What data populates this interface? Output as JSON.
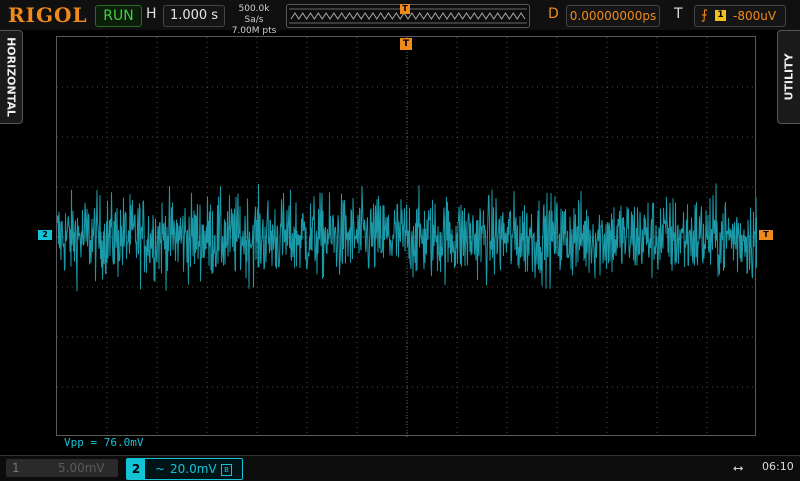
{
  "header": {
    "brand": "RIGOL",
    "run_state": "RUN",
    "horizontal_label": "H",
    "timebase": "1.000 s",
    "sample_rate": "500.0k Sa/s",
    "memory_depth": "7.00M pts",
    "delay_label": "D",
    "delay_value": "0.00000000ps",
    "trigger_label": "T",
    "trigger_source": "1",
    "trigger_level": "-800uV",
    "trigger_position_marker": "T"
  },
  "side_tabs": {
    "left": "HORIZONTAL",
    "right": "UTILITY"
  },
  "markers": {
    "channel2": "2",
    "trigger_level": "T",
    "trigger_position": "T"
  },
  "measurement": {
    "text": "Vpp = 76.0mV"
  },
  "channels": {
    "ch1": {
      "number": "1",
      "scale": "5.00mV"
    },
    "ch2": {
      "number": "2",
      "coupling": "~",
      "scale": "20.0mV",
      "bw_icon": "B"
    }
  },
  "status": {
    "usb_icon": "usb-icon",
    "time": "06:10"
  },
  "colors": {
    "brand": "#f08a1c",
    "channel2": "#13c4d6",
    "run": "#40d040",
    "trigger": "#f08a1c"
  },
  "chart_data": {
    "type": "line",
    "title": "",
    "xlabel": "",
    "ylabel": "",
    "xdivs": 14,
    "ydivs": 8,
    "grid": true,
    "series": [
      {
        "name": "",
        "vpp_mV": 76.0,
        "scale_mV_per_div": 20.0
      }
    ]
  }
}
